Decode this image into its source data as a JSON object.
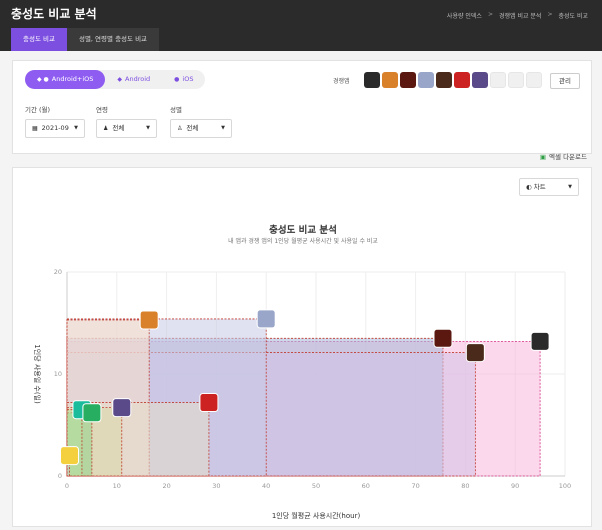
{
  "header": {
    "title": "충성도 비교 분석",
    "breadcrumb": [
      "사용량 인덱스",
      "경쟁앱 비교 분석",
      "충성도 비교"
    ]
  },
  "tabs": [
    {
      "label": "충성도 비교",
      "active": true
    },
    {
      "label": "성별, 연령별 충성도 비교",
      "active": false
    }
  ],
  "platforms": [
    {
      "label": "Android+iOS",
      "icon": "apple-android-icon",
      "active": true
    },
    {
      "label": "Android",
      "icon": "android-icon",
      "active": false
    },
    {
      "label": "iOS",
      "icon": "apple-icon",
      "active": false
    }
  ],
  "competitors": {
    "label": "경쟁앱",
    "manage_label": "관리",
    "icon_colors": [
      "#2a2a2a",
      "#d9802a",
      "#5a1810",
      "#9aa6c9",
      "#4a2a1a",
      "#cc2222",
      "#5a4a8a"
    ],
    "empty_slots": 3
  },
  "filters": {
    "period": {
      "label": "기간 (월)",
      "value": "2021-09"
    },
    "age": {
      "label": "연령",
      "value": "전체"
    },
    "gender": {
      "label": "성별",
      "value": "전체"
    }
  },
  "excel_label": "엑셀 다운로드",
  "chart_type_select": "차트",
  "chart_data": {
    "type": "scatter",
    "title": "충성도 비교 분석",
    "subtitle": "내 앱과 경쟁 앱의 1인당 월평균 사용시간 및 사용일 수 비교",
    "xlabel": "1인당 월평균 사용시간(hour)",
    "ylabel": "1인당 사용일 수(일)",
    "xlim": [
      0,
      100
    ],
    "ylim": [
      0,
      20
    ],
    "xticks": [
      0,
      10,
      20,
      30,
      40,
      50,
      60,
      70,
      80,
      90,
      100
    ],
    "yticks": [
      0,
      10,
      20
    ],
    "grid": true,
    "points": [
      {
        "x": 0.5,
        "y": 2.0,
        "color": "#f4d03f",
        "fill": "#c8c8c8",
        "border": "#c0392b"
      },
      {
        "x": 3.0,
        "y": 6.5,
        "color": "#1abc9c",
        "fill": "#b8e0a0",
        "border": "#c0392b"
      },
      {
        "x": 5.0,
        "y": 6.2,
        "color": "#27ae60",
        "fill": "#8fd18a",
        "border": "#c0392b"
      },
      {
        "x": 11.0,
        "y": 6.7,
        "color": "#5a4a8a",
        "fill": "#d8d8a8",
        "border": "#c0392b"
      },
      {
        "x": 28.5,
        "y": 7.2,
        "color": "#cc2222",
        "fill": "#e6dcc8",
        "border": "#c0392b"
      },
      {
        "x": 16.5,
        "y": 15.3,
        "color": "#d9802a",
        "fill": "#fde0c8",
        "border": "#c0392b"
      },
      {
        "x": 40.0,
        "y": 15.4,
        "color": "#9aa6c9",
        "fill": "#c7cbe6",
        "border": "#c0392b"
      },
      {
        "x": 75.5,
        "y": 13.5,
        "color": "#5a1810",
        "fill": "#a6b8d8",
        "border": "#c0392b"
      },
      {
        "x": 82.0,
        "y": 12.1,
        "color": "#4a2a1a",
        "fill": "#d3c2e8",
        "border": "#c0392b"
      },
      {
        "x": 95.0,
        "y": 13.2,
        "color": "#2a2a2a",
        "fill": "#f7b8dc",
        "border": "#d63384"
      }
    ]
  }
}
